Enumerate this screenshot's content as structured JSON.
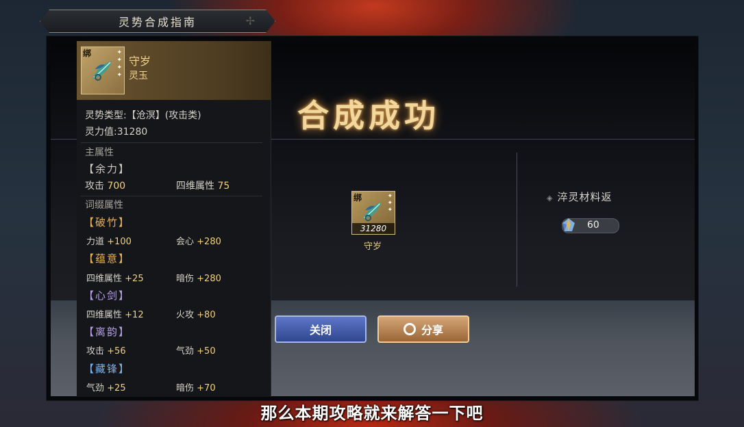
{
  "banner": {
    "title": "灵势合成指南"
  },
  "result": {
    "title": "合成成功",
    "item_bind": "绑",
    "item_power": "31280",
    "item_name": "守岁",
    "return_label": "淬灵材料返",
    "return_amount": "60"
  },
  "buttons": {
    "close": "关闭",
    "share": "分享"
  },
  "panel": {
    "bind": "绑",
    "name": "守岁",
    "sub": "灵玉",
    "type_line": "灵势类型:【沧溟】(攻击类)",
    "power_line": "灵力值:31280",
    "main_header": "主属性",
    "main_group": "【余力】",
    "main_stats": [
      {
        "label": "攻击",
        "value": "700"
      },
      {
        "label": "四维属性",
        "value": "75"
      }
    ],
    "affix_header": "词缀属性",
    "affixes": [
      {
        "tag": "【破竹】",
        "color": "#e8b25a",
        "stats": [
          {
            "label": "力道",
            "value": "+100"
          },
          {
            "label": "会心",
            "value": "+280"
          }
        ]
      },
      {
        "tag": "【蕴意】",
        "color": "#e8b25a",
        "stats": [
          {
            "label": "四维属性",
            "value": "+25"
          },
          {
            "label": "暗伤",
            "value": "+280"
          }
        ]
      },
      {
        "tag": "【心剑】",
        "color": "#b8a0e8",
        "stats": [
          {
            "label": "四维属性",
            "value": "+12"
          },
          {
            "label": "火攻",
            "value": "+80"
          }
        ]
      },
      {
        "tag": "【离韵】",
        "color": "#b8a0e8",
        "stats": [
          {
            "label": "攻击",
            "value": "+56"
          },
          {
            "label": "气劲",
            "value": "+50"
          }
        ]
      },
      {
        "tag": "【藏锋】",
        "color": "#7fb2ec",
        "stats": [
          {
            "label": "气劲",
            "value": "+25"
          },
          {
            "label": "暗伤",
            "value": "+70"
          }
        ]
      }
    ]
  },
  "subtitle": "那么本期攻略就来解答一下吧",
  "colors": {
    "gold": "#f2d27e",
    "accent_blue": "#2f468f",
    "accent_orange": "#9a6637"
  }
}
